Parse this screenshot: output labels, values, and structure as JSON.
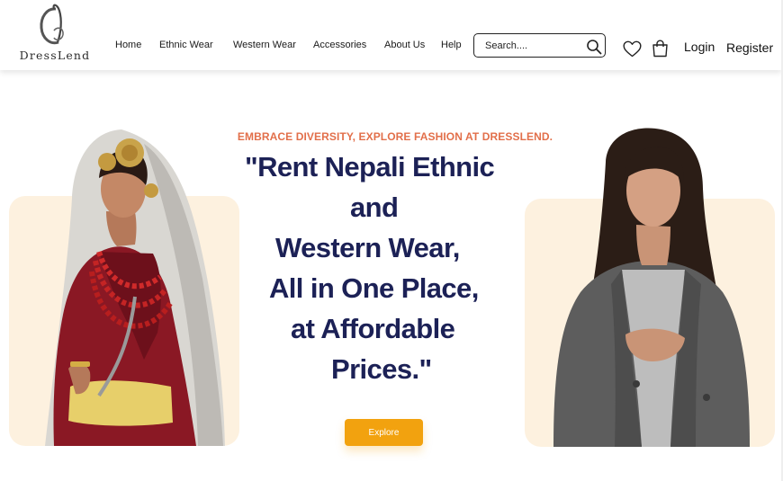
{
  "header": {
    "logo_text": "DressLend",
    "nav": [
      "Home",
      "Ethnic Wear",
      "Western Wear",
      "Accessories",
      "About Us",
      "Help"
    ],
    "search_placeholder": "Search....",
    "login_label": "Login",
    "register_label": "Register",
    "icons": [
      "search-icon",
      "heart-icon",
      "shopping-bag-icon"
    ]
  },
  "hero": {
    "tagline": "EMBRACE DIVERSITY, EXPLORE FASHION AT DRESSLEND.",
    "headline_lines": [
      "\"Rent Nepali Ethnic",
      "and",
      "Western Wear,",
      "All in One Place,",
      "at Affordable",
      "Prices.\""
    ],
    "explore_label": "Explore"
  },
  "colors": {
    "accent": "#f2a20f",
    "tagline": "#e26f4a",
    "headline": "#1c2156",
    "card_background": "#fdf1df"
  }
}
